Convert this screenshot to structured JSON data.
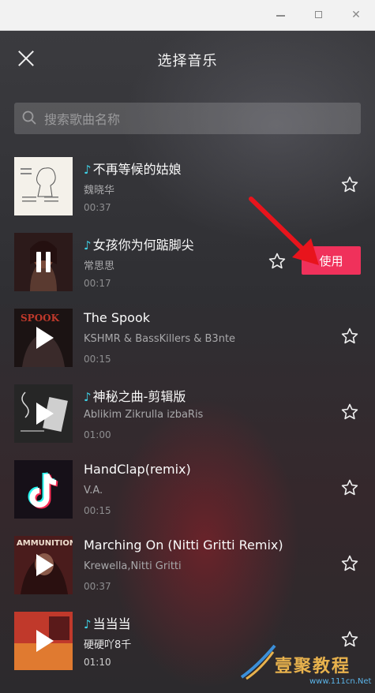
{
  "window": {
    "minimize": "–",
    "maximize": "□",
    "close": "✕"
  },
  "header": {
    "title": "选择音乐",
    "close_icon": "close-icon"
  },
  "search": {
    "placeholder": "搜索歌曲名称"
  },
  "colors": {
    "accent": "#f0315b",
    "note": "#3fd3e8"
  },
  "songs": [
    {
      "title": "不再等候的姑娘",
      "has_note": true,
      "artist": "魏晓华",
      "duration": "00:37",
      "state": "none"
    },
    {
      "title": "女孩你为何踮脚尖",
      "has_note": true,
      "artist": "常思思",
      "duration": "00:17",
      "state": "playing",
      "action": "使用"
    },
    {
      "title": "The Spook",
      "has_note": false,
      "artist": "KSHMR & BassKillers & B3nte",
      "duration": "00:15",
      "state": "paused"
    },
    {
      "title": "神秘之曲-剪辑版",
      "has_note": true,
      "artist": "Ablikim Zikrulla izbaRis",
      "duration": "01:00",
      "state": "paused"
    },
    {
      "title": "HandClap(remix)",
      "has_note": false,
      "artist": "V.A.",
      "duration": "00:15",
      "state": "none"
    },
    {
      "title": "Marching On (Nitti Gritti Remix)",
      "has_note": false,
      "artist": "Krewella,Nitti Gritti",
      "duration": "00:37",
      "state": "paused"
    },
    {
      "title": "当当当",
      "has_note": true,
      "artist": "硬硬吖8千",
      "duration": "01:10",
      "state": "paused"
    }
  ],
  "watermark": {
    "text": "壹聚教程",
    "sub": "www.111cn.Net"
  }
}
